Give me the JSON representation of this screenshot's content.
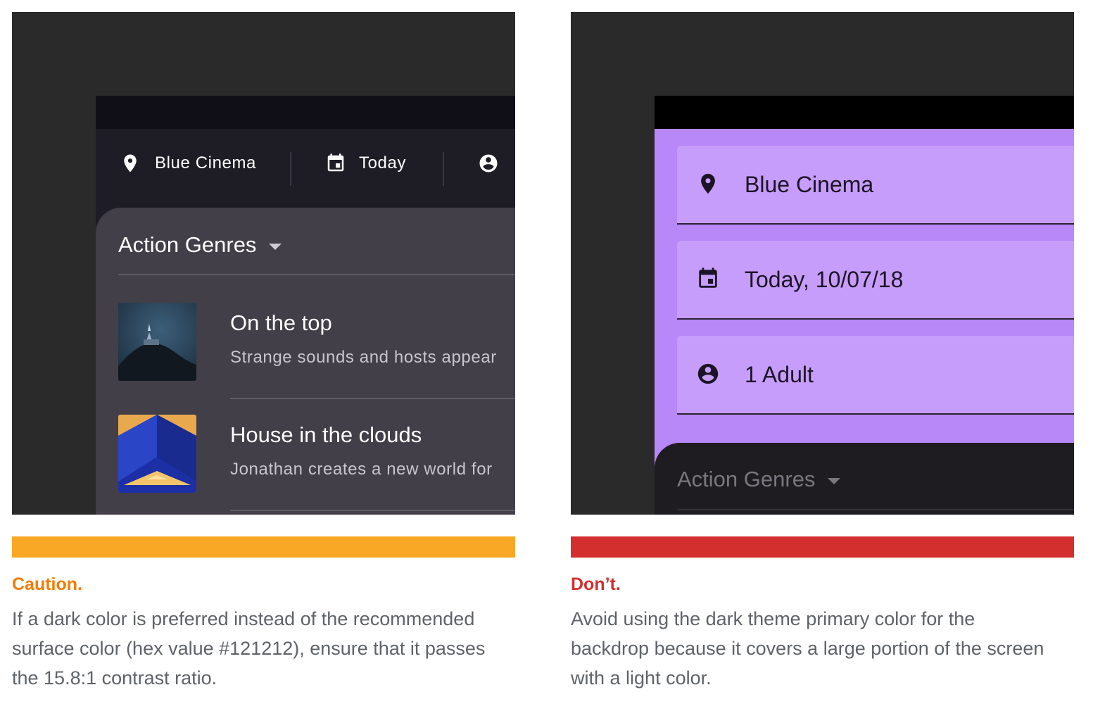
{
  "caution_example": {
    "location": "Blue Cinema",
    "date": "Today",
    "genre": "Action Genres",
    "movies": [
      {
        "title": "On the top",
        "description": "Strange sounds and hosts appear"
      },
      {
        "title": "House in the clouds",
        "description": "Jonathan creates a new world for"
      }
    ],
    "colors": {
      "backdrop": "#1e1c25",
      "status_bar": "#100e17",
      "front_layer": "#423f48"
    }
  },
  "dont_example": {
    "location": "Blue Cinema",
    "date": "Today, 10/07/18",
    "people": "1 Adult",
    "genre": "Action Genres",
    "colors": {
      "backdrop": "#b887f8",
      "field": "#c79dfb",
      "status_bar": "#000000",
      "front_layer": "#1e1c20"
    }
  },
  "captions": {
    "caution": {
      "heading": "Caution.",
      "lines": [
        "If a dark color is preferred instead of the recommended",
        "surface color (hex value #121212), ensure that it passes",
        "the 15.8:1 contrast ratio."
      ],
      "color": "#f57c00",
      "bar_color": "#f9a825"
    },
    "dont": {
      "heading": "Don’t.",
      "lines": [
        "Avoid using the dark theme primary color for the",
        "backdrop because it covers a large portion of the screen",
        "with a light color."
      ],
      "color": "#d32f2f",
      "bar_color": "#d32f2f"
    }
  }
}
